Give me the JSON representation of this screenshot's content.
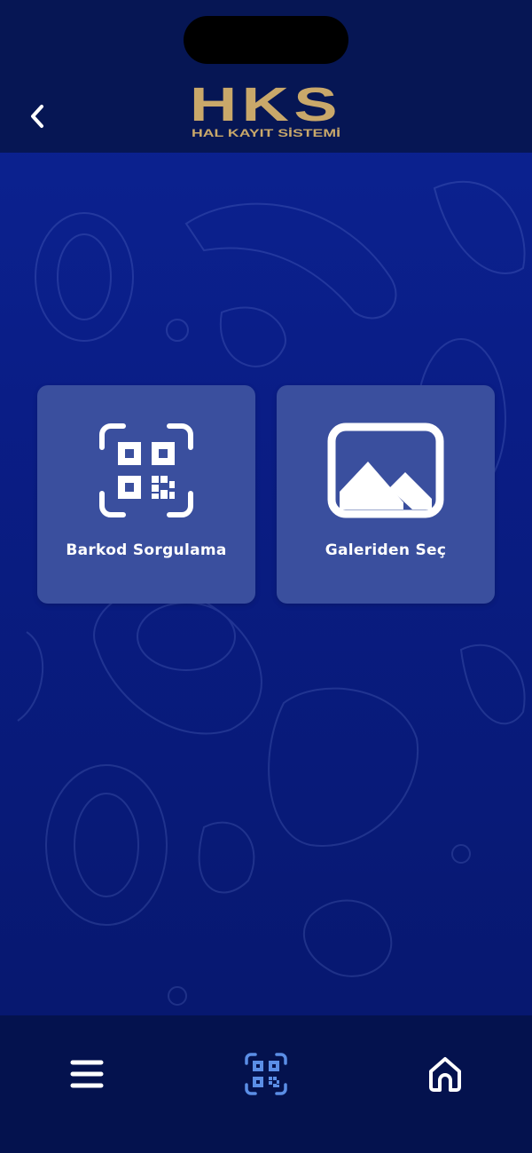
{
  "header": {
    "logo_title": "HKS",
    "logo_subtitle": "HAL KAYIT SİSTEMİ",
    "back_icon": "chevron-left-icon"
  },
  "actions": [
    {
      "label": "Barkod Sorgulama",
      "icon": "qr-code-icon"
    },
    {
      "label": "Galeriden Seç",
      "icon": "gallery-image-icon"
    }
  ],
  "bottom_nav": {
    "items": [
      {
        "icon": "menu-icon",
        "active": false
      },
      {
        "icon": "qr-scan-icon",
        "active": true
      },
      {
        "icon": "home-icon",
        "active": false
      }
    ]
  },
  "colors": {
    "header_bg": "#061654",
    "body_bg": "#0a1d86",
    "tile_bg": "#3a4f9e",
    "logo_gold": "#c9a86a",
    "active_nav": "#5b8ee6",
    "icon_white": "#ffffff"
  }
}
